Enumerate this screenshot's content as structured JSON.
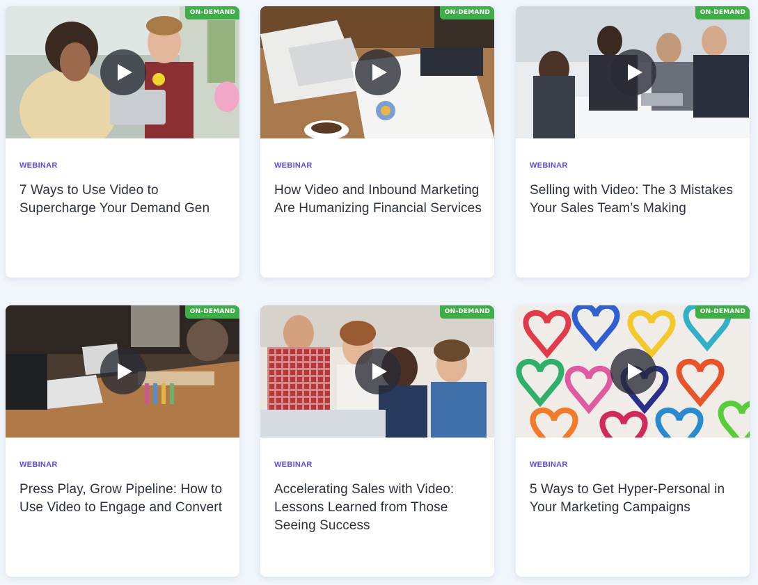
{
  "cards": [
    {
      "badge": "ON-DEMAND",
      "type": "WEBINAR",
      "title": "7 Ways to Use Video to Supercharge Your Demand Gen"
    },
    {
      "badge": "ON-DEMAND",
      "type": "WEBINAR",
      "title": "How Video and Inbound Marketing Are Humanizing Financial Services"
    },
    {
      "badge": "ON-DEMAND",
      "type": "WEBINAR",
      "title": "Selling with Video: The 3 Mistakes Your Sales Team’s Making"
    },
    {
      "badge": "ON-DEMAND",
      "type": "WEBINAR",
      "title": "Press Play, Grow Pipeline: How to Use Video to Engage and Convert"
    },
    {
      "badge": "ON-DEMAND",
      "type": "WEBINAR",
      "title": "Accelerating Sales with Video: Lessons Learned from Those Seeing Success"
    },
    {
      "badge": "ON-DEMAND",
      "type": "WEBINAR",
      "title": "5 Ways to Get Hyper-Personal in Your Marketing Campaigns"
    }
  ],
  "colors": {
    "badge": "#3fae49",
    "type_label": "#5b4ee6",
    "title": "#2c3140",
    "page_bg": "#f1f6fd"
  },
  "icons": {
    "play": "play-icon"
  }
}
